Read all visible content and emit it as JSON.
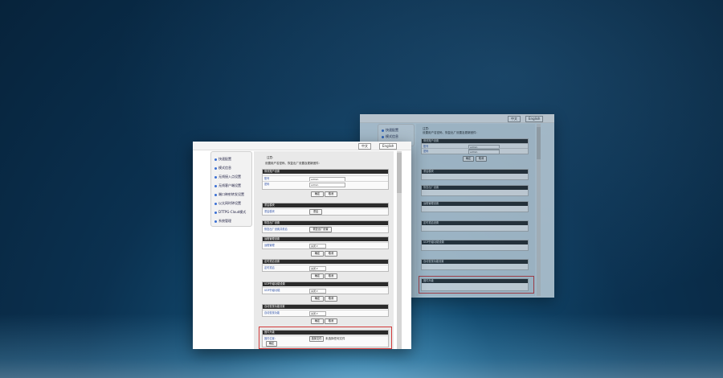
{
  "lang": {
    "zh": "中文",
    "en": "English"
  },
  "sidebar": {
    "items": [
      "快速配置",
      "模式信息",
      "无线接入点设置",
      "无线客户端设置",
      "端口映射转发设置",
      "以太网时钟设置",
      "DTTPG-Cloud模式",
      "系统管理"
    ]
  },
  "intro": {
    "line1": "注意:",
    "line2": "设置用户名密码、恢复出厂设置及更新固件:"
  },
  "account": {
    "title": "修改账户设置",
    "user_label": "账号",
    "user_value": "admin",
    "pass_label": "密码",
    "pass_value": "admin",
    "ok": "确定",
    "cancel": "取消"
  },
  "reboot": {
    "title": "重启模块",
    "label": "重启模块",
    "btn": "重启"
  },
  "factory": {
    "title": "恢复出厂设置",
    "label": "恢复出厂设置并重启",
    "btn": "恢复出厂设置"
  },
  "remote": {
    "title": "远程管理设置",
    "label": "远程管理",
    "value": "关闭",
    "ok": "确定",
    "cancel": "取消"
  },
  "timing": {
    "title": "定时重启设置",
    "label": "定时重启",
    "value": "关闭",
    "ok": "确定",
    "cancel": "取消"
  },
  "udp": {
    "title": "UDP升级功能设置",
    "label": "UDP升级功能",
    "value": "关闭",
    "ok": "确定",
    "cancel": "取消"
  },
  "auto": {
    "title": "自动查找功能设置",
    "label": "自动查找功能",
    "value": "关闭",
    "ok": "确定",
    "cancel": "取消"
  },
  "firmware": {
    "title": "固件升级",
    "label": "固件位置:",
    "choose": "选择文件",
    "nofile": "未选择任何文件",
    "submit": "确定"
  },
  "back": {
    "sidebar": [
      "快速配置",
      "模式信息"
    ],
    "sections": [
      "修改账户设置",
      "重启模块",
      "恢复出厂设置",
      "远程管理设置",
      "定时重启设置",
      "UDP升级功能设置",
      "自动查找功能设置",
      "固件升级"
    ]
  },
  "colors": {
    "highlight": "#d23a3a",
    "header": "#2b2b2b",
    "accent": "#3b6fd4"
  }
}
